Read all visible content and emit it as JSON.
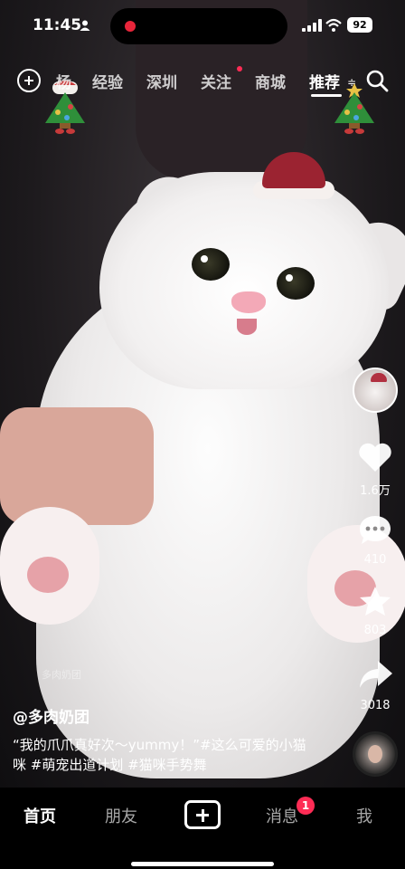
{
  "status_bar": {
    "time": "11:45",
    "battery": "92"
  },
  "top_nav": {
    "tabs": [
      {
        "label": "杨"
      },
      {
        "label": "经验"
      },
      {
        "label": "深圳"
      },
      {
        "label": "关注"
      },
      {
        "label": "商城"
      },
      {
        "label": "推荐"
      }
    ],
    "active_tab": "推荐",
    "more_indicator": "≑"
  },
  "video": {
    "watermark": "多肉奶团"
  },
  "right_rail": {
    "likes": "1.6万",
    "comments": "410",
    "favorites": "803",
    "shares": "3018"
  },
  "caption": {
    "author": "@多肉奶团",
    "text": "“我的爪爪真好次～yummy！”#这么可爱的小猫咪 #萌宠出道计划 #猫咪手势舞"
  },
  "bottom_nav": {
    "items": [
      {
        "label": "首页"
      },
      {
        "label": "朋友"
      },
      {
        "label": "消息"
      },
      {
        "label": "我"
      }
    ],
    "messages_badge": "1"
  },
  "colors": {
    "accent": "#fe2c55",
    "background": "#000000"
  }
}
